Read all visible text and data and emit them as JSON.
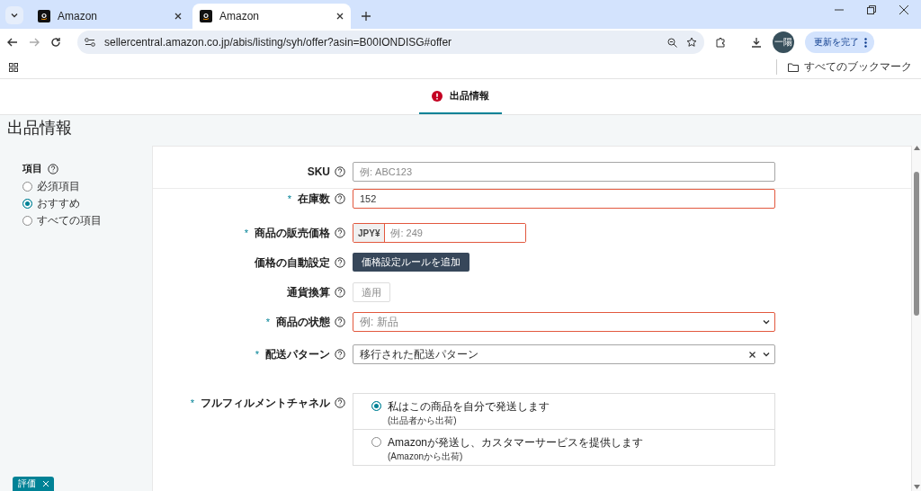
{
  "browser": {
    "tabs": [
      {
        "title": "Amazon",
        "selected": false
      },
      {
        "title": "Amazon",
        "selected": true
      }
    ],
    "url": "sellercentral.amazon.co.jp/abis/listing/syh/offer?asin=B00IONDISG#offer",
    "avatar": "一陽",
    "update_button": "更新を完了",
    "bookmarks": "すべてのブックマーク"
  },
  "page": {
    "nav_tabs": [
      {
        "label": "出品情報",
        "selected": true,
        "error": true
      }
    ],
    "heading": "出品情報",
    "filter": {
      "label": "項目",
      "options": [
        {
          "label": "必須項目",
          "selected": false
        },
        {
          "label": "おすすめ",
          "selected": true
        },
        {
          "label": "すべての項目",
          "selected": false
        }
      ]
    },
    "fields": [
      {
        "kind": "text",
        "label": "SKU",
        "required": false,
        "error": false,
        "placeholder": "例: ABC123"
      },
      {
        "kind": "text",
        "label": "在庫数",
        "required": true,
        "error": true,
        "value": "152"
      },
      {
        "kind": "price",
        "label": "商品の販売価格",
        "required": true,
        "error": true,
        "currency": "JPY¥",
        "placeholder": "例: 249"
      },
      {
        "kind": "button",
        "label": "価格の自動設定",
        "required": false,
        "button": "価格設定ルールを追加"
      },
      {
        "kind": "small_button",
        "label": "通貨換算",
        "required": false,
        "button": "適用"
      },
      {
        "kind": "select",
        "label": "商品の状態",
        "required": true,
        "error": true,
        "placeholder": "例: 新品"
      },
      {
        "kind": "select_clearable",
        "label": "配送パターン",
        "required": true,
        "error": false,
        "value": "移行された配送パターン"
      },
      {
        "kind": "radio_group",
        "label": "フルフィルメントチャネル",
        "required": true,
        "options": [
          {
            "title": "私はこの商品を自分で発送します",
            "sub": "(出品者から出荷)",
            "selected": true
          },
          {
            "title": "Amazonが発送し、カスタマーサービスを提供します",
            "sub": "(Amazonから出荷)",
            "selected": false
          }
        ]
      }
    ],
    "required_mark": "*",
    "feedback": "評価"
  }
}
